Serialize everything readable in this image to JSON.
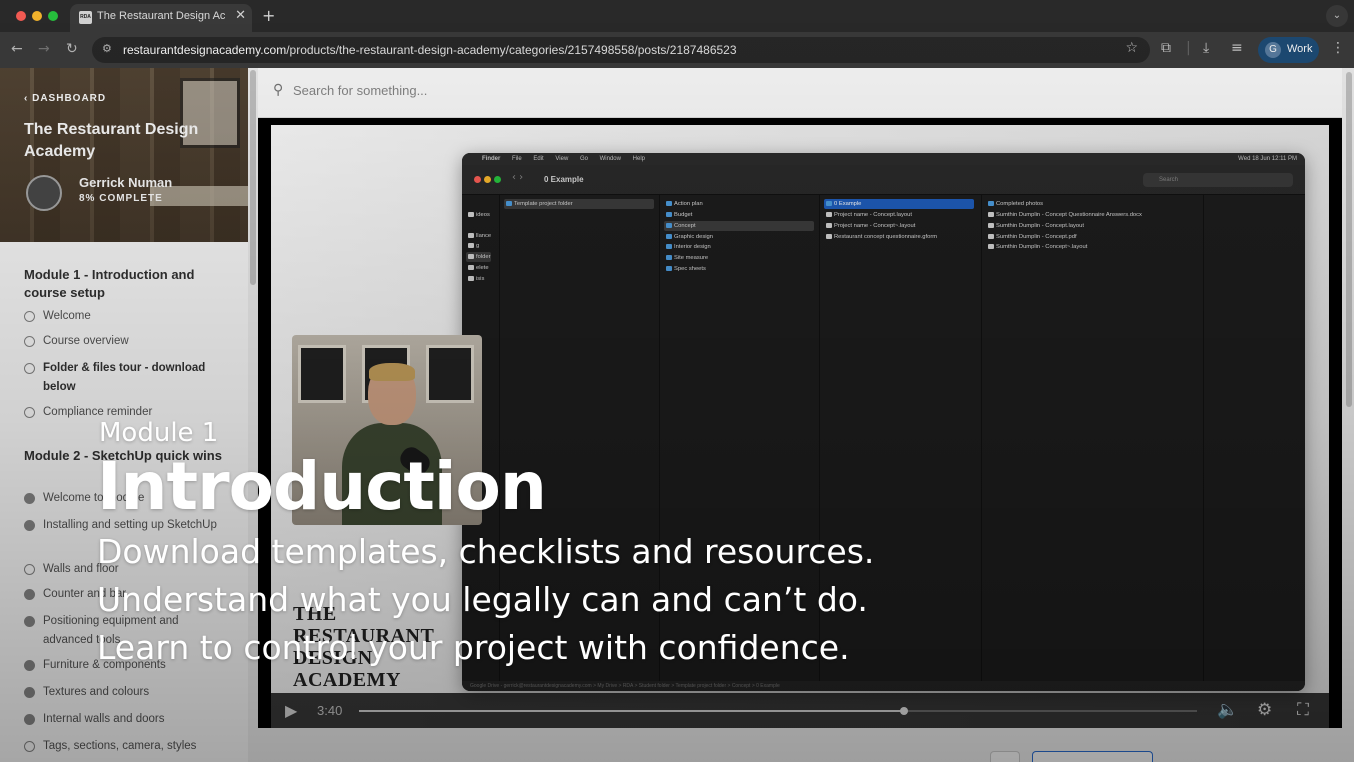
{
  "browser": {
    "tab_title": "The Restaurant Design Academy",
    "tab_favicon": "RDA",
    "new_tab": "+",
    "url_host": "restaurantdesignacademy.com",
    "url_path": "/products/the-restaurant-design-academy/categories/2157498558/posts/2187486523",
    "profile_initial": "G",
    "profile_label": "Work"
  },
  "sidebar": {
    "back_label": "DASHBOARD",
    "course_title": "The Restaurant Design Academy",
    "student_name": "Gerrick Numan",
    "progress_label": "8% COMPLETE",
    "modules": [
      {
        "title": "Module 1 - Introduction and course setup",
        "lessons": [
          {
            "label": "Welcome",
            "status": "in-progress",
            "bold": false
          },
          {
            "label": "Course overview",
            "status": "in-progress",
            "bold": false
          },
          {
            "label": "Folder & files tour - download below",
            "status": "in-progress",
            "bold": true
          },
          {
            "label": "Compliance reminder",
            "status": "in-progress",
            "bold": false
          }
        ]
      },
      {
        "title": "Module 2 - SketchUp quick wins",
        "lessons": [
          {
            "label": "Welcome to module",
            "status": "done",
            "bold": false
          },
          {
            "label": "Installing and setting up SketchUp",
            "status": "done",
            "bold": false
          },
          {
            "label": "Walls and floor",
            "status": "in-progress",
            "bold": false
          },
          {
            "label": "Counter and bar",
            "status": "done",
            "bold": false
          },
          {
            "label": "Positioning equipment and advanced tools",
            "status": "done",
            "bold": false
          },
          {
            "label": "Furniture & components",
            "status": "done",
            "bold": false
          },
          {
            "label": "Textures and colours",
            "status": "done",
            "bold": false
          },
          {
            "label": "Internal walls and doors",
            "status": "done",
            "bold": false
          },
          {
            "label": "Tags, sections, camera, styles",
            "status": "in-progress",
            "bold": false
          }
        ]
      }
    ]
  },
  "search": {
    "placeholder": "Search for something..."
  },
  "video": {
    "overlay_kicker": "Module 1",
    "overlay_title": "Introduction",
    "overlay_lines": [
      "Download templates, checklists and resources.",
      "Understand what you legally can and can’t do.",
      "Learn to control your project with confidence."
    ],
    "brand_text": "THE RESTAURANT DESIGN ACADEMY",
    "current_time": "3:40",
    "progress": 0.65,
    "finder": {
      "menubar": [
        "Finder",
        "File",
        "Edit",
        "View",
        "Go",
        "Window",
        "Help"
      ],
      "clock": "Wed 18 Jun 12:11 PM",
      "window_title": "0 Example",
      "search_placeholder": "Search",
      "col0": [
        "ideos",
        "llance",
        "g",
        "folder",
        "elete",
        "isis"
      ],
      "col1": [
        "Template project folder"
      ],
      "col2": [
        "Action plan",
        "Budget",
        "Concept",
        "Graphic design",
        "Interior design",
        "Site measure",
        "Spec sheets"
      ],
      "col3": [
        "0 Example",
        "Project name - Concept.layout",
        "Project name - Concept~.layout",
        "Restaurant concept questionnaire.gform"
      ],
      "col4": [
        "Completed photos",
        "Sumthin Dumplin - Concept Questionnaire Answers.docx",
        "Sumthin Dumplin - Concept.layout",
        "Sumthin Dumplin - Concept.pdf",
        "Sumthin Dumplin - Concept~.layout"
      ],
      "pathbar": "Google Drive - gerrick@restaurantdesignacademy.com > My Drive > RDA > Student folder > Template project folder > Concept > 0 Example"
    }
  }
}
